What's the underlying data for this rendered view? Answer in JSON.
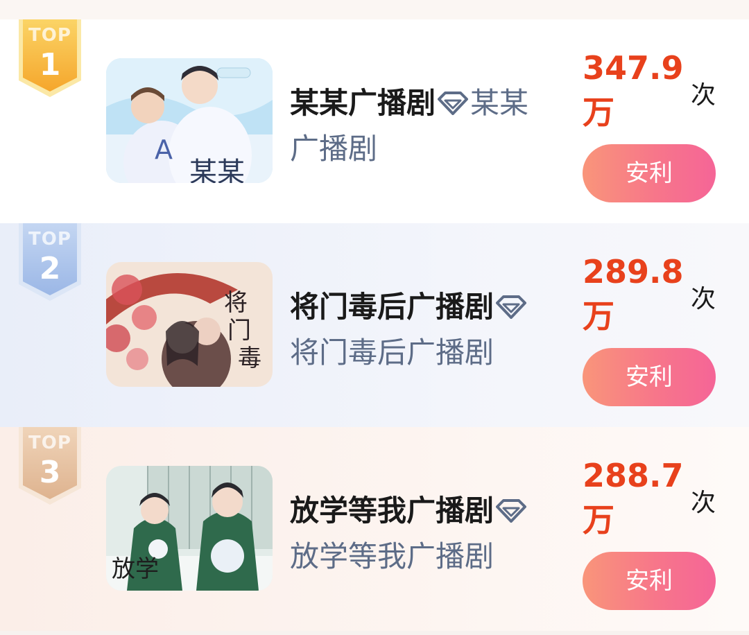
{
  "colors": {
    "count_red": "#e8411c",
    "button_gradient": [
      "#f9957a",
      "#f56597"
    ],
    "gold_badge": "#f6b53b",
    "blue_badge": "#a9c3ea",
    "bronze_badge": "#e9c7a9"
  },
  "ranking": [
    {
      "rank_label": "TOP",
      "rank": "1",
      "cover_icon": "cover-image",
      "title_main": "某某广播剧",
      "title_sub": "某某广播剧",
      "count_value": "347.9万",
      "count_unit": "次",
      "action_label": "安利"
    },
    {
      "rank_label": "TOP",
      "rank": "2",
      "cover_icon": "cover-image",
      "title_main": "将门毒后广播剧",
      "title_sub": "将门毒后广播剧",
      "count_value": "289.8万",
      "count_unit": "次",
      "action_label": "安利"
    },
    {
      "rank_label": "TOP",
      "rank": "3",
      "cover_icon": "cover-image",
      "title_main": "放学等我广播剧",
      "title_sub": "放学等我广播剧",
      "count_value": "288.7万",
      "count_unit": "次",
      "action_label": "安利"
    }
  ]
}
